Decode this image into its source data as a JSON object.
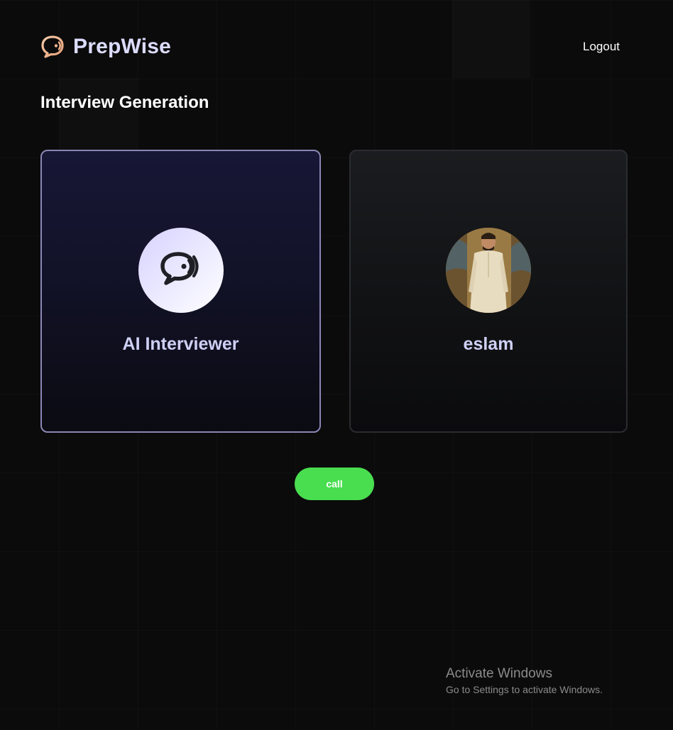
{
  "app": {
    "brand_name": "PrepWise",
    "logo_icon": "chat-bubble-audio-icon"
  },
  "nav": {
    "logout_label": "Logout"
  },
  "page": {
    "title": "Interview Generation"
  },
  "cards": {
    "ai": {
      "name": "AI Interviewer",
      "avatar_icon": "chat-bubble-audio-icon"
    },
    "user": {
      "name": "eslam",
      "avatar": "user-photo"
    }
  },
  "actions": {
    "call_label": "call"
  },
  "watermark": {
    "title": "Activate Windows",
    "subtitle": "Go to Settings to activate Windows."
  },
  "colors": {
    "brand_text": "#dcdcff",
    "call_button": "#49de50",
    "ai_card_border": "#8a86b6",
    "background": "#0b0b0b"
  }
}
